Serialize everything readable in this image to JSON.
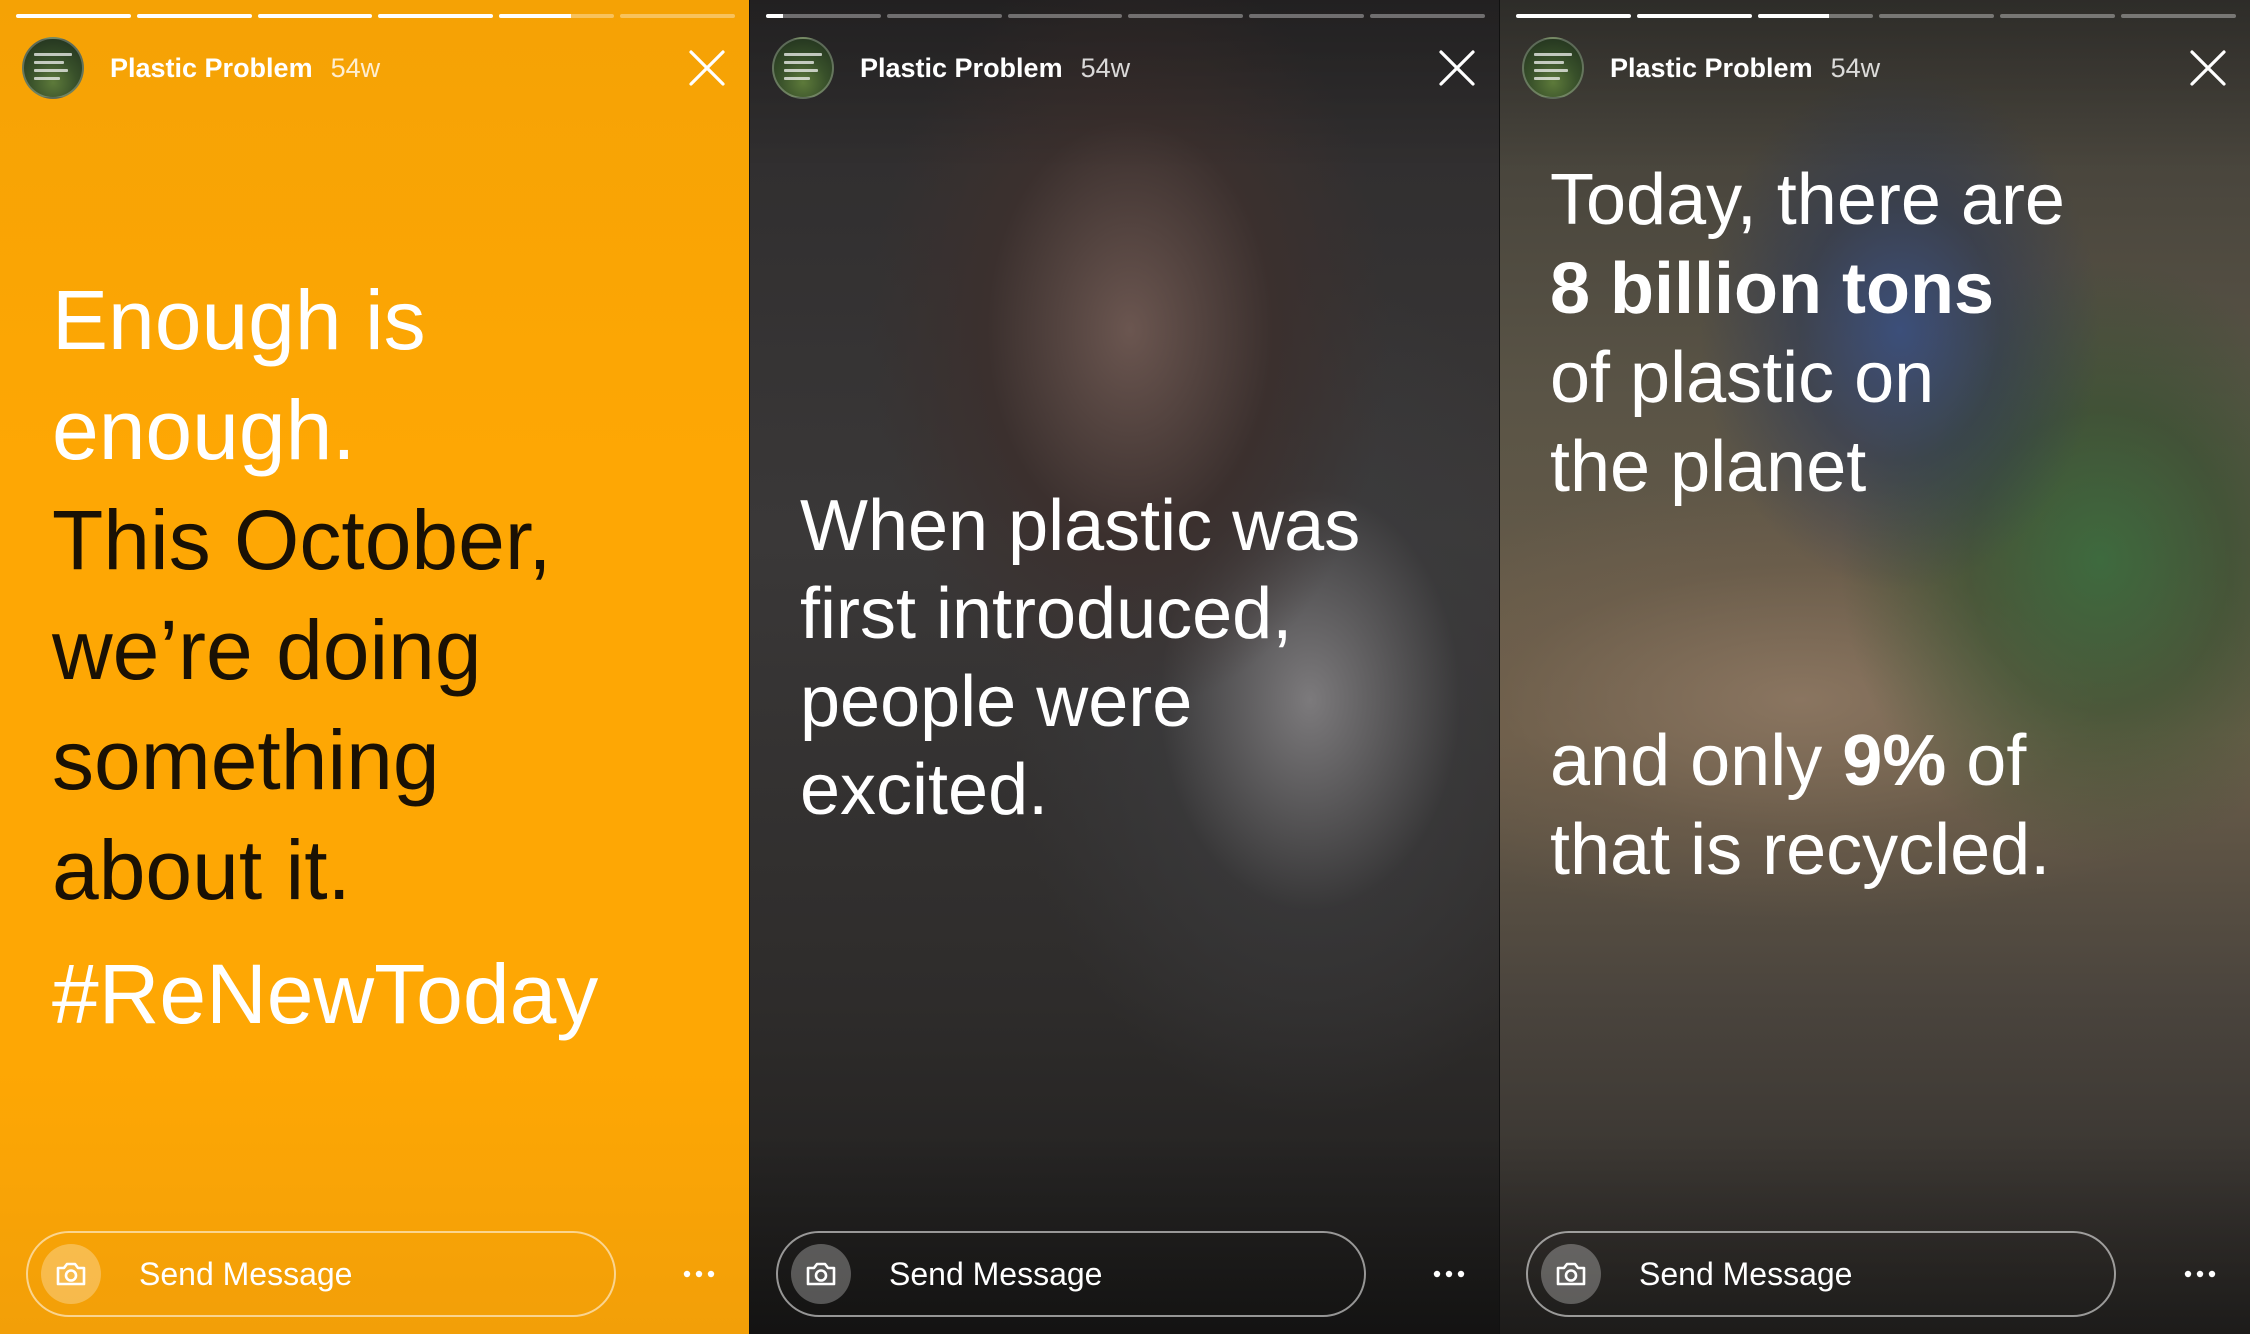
{
  "stories": [
    {
      "account": "Plastic Problem",
      "age": "54w",
      "progress": [
        1,
        1,
        1,
        1,
        0.62,
        0
      ],
      "lines": [
        "Enough is",
        "enough.",
        "This October,",
        "we’re doing",
        "something",
        "about it.",
        "#ReNewToday"
      ],
      "send_message": "Send Message"
    },
    {
      "account": "Plastic Problem",
      "age": "54w",
      "progress": [
        0.15,
        0,
        0,
        0,
        0,
        0
      ],
      "lines": [
        "When plastic was",
        "first introduced,",
        "people were",
        "excited."
      ],
      "send_message": "Send Message"
    },
    {
      "account": "Plastic Problem",
      "age": "54w",
      "progress": [
        1,
        1,
        0.62,
        0,
        0,
        0
      ],
      "lines": {
        "l1": "Today, there are",
        "l2": "8 billion tons",
        "l3": "of plastic on",
        "l4": "the planet",
        "l5a": "and only ",
        "l5b": "9%",
        "l5c": " of",
        "l6": "that is recycled."
      },
      "send_message": "Send Message"
    }
  ],
  "colors": {
    "story1_background": "#fea704",
    "story1_dark_text": "#1a1104",
    "text": "#ffffff"
  },
  "icons": {
    "close": "close-icon",
    "camera": "camera-icon",
    "more": "more-options-icon"
  }
}
